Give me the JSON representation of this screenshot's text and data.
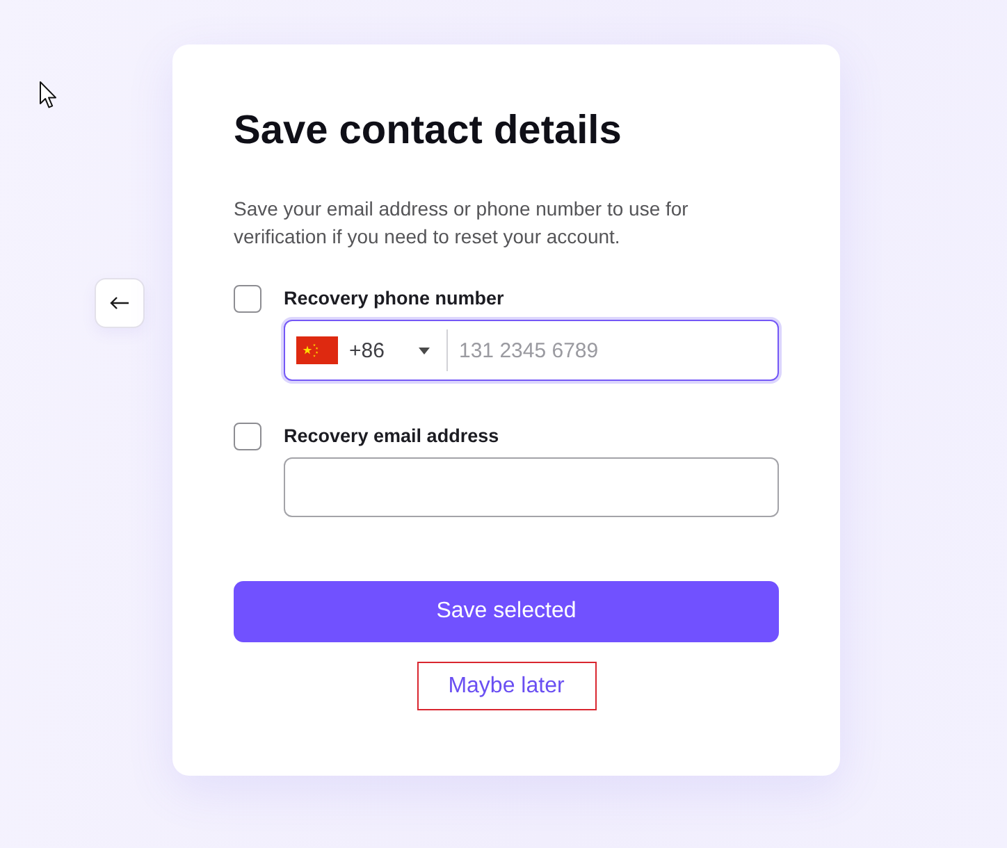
{
  "title": "Save contact details",
  "description": "Save your email address or phone number to use for verification if you need to reset your account.",
  "options": [
    {
      "kind": "phone",
      "label": "Recovery phone number",
      "checked": false,
      "focused": true,
      "country_code": "+86",
      "placeholder": "131 2345 6789"
    },
    {
      "kind": "email",
      "label": "Recovery email address",
      "checked": false,
      "focused": false
    }
  ],
  "primary_button": {
    "label": "Save selected"
  },
  "secondary_button": {
    "label": "Maybe later",
    "highlighted": true
  }
}
